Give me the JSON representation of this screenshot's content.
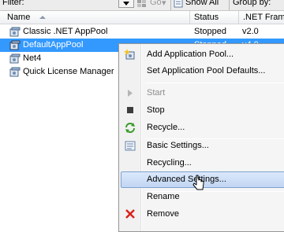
{
  "toolbar": {
    "filter_label": "Filter:",
    "go_label": "Go",
    "show_all_label": "Show All",
    "group_by_label": "Group by:"
  },
  "columns": {
    "name": "Name",
    "status": "Status",
    "framework": ".NET Frame"
  },
  "rows": [
    {
      "name": "Classic .NET AppPool",
      "status": "Stopped",
      "framework": "v2.0",
      "selected": false
    },
    {
      "name": "DefaultAppPool",
      "status": "Stopped",
      "framework": "v4.0",
      "selected": true
    },
    {
      "name": "Net4",
      "status": "",
      "framework": "",
      "selected": false
    },
    {
      "name": "Quick License Manager",
      "status": "",
      "framework": "",
      "selected": false
    }
  ],
  "context_menu": {
    "items": [
      {
        "label": "Add Application Pool...",
        "icon": "add-app-pool-icon",
        "disabled": false
      },
      {
        "label": "Set Application Pool Defaults...",
        "icon": "",
        "disabled": false
      },
      {
        "label": "Start",
        "icon": "play-icon",
        "disabled": true
      },
      {
        "label": "Stop",
        "icon": "stop-icon",
        "disabled": false
      },
      {
        "label": "Recycle...",
        "icon": "recycle-icon",
        "disabled": false
      },
      {
        "label": "Basic Settings...",
        "icon": "settings-sheet-icon",
        "disabled": false
      },
      {
        "label": "Recycling...",
        "icon": "",
        "disabled": false
      },
      {
        "label": "Advanced Settings...",
        "icon": "",
        "disabled": false,
        "highlighted": true
      },
      {
        "label": "Rename",
        "icon": "",
        "disabled": false
      },
      {
        "label": "Remove",
        "icon": "remove-x-icon",
        "disabled": false
      }
    ]
  },
  "colors": {
    "selection": "#3399ff",
    "menu_highlight": "#c1d6f3",
    "remove_red": "#d9231b",
    "recycle_green": "#3a9a2a"
  }
}
